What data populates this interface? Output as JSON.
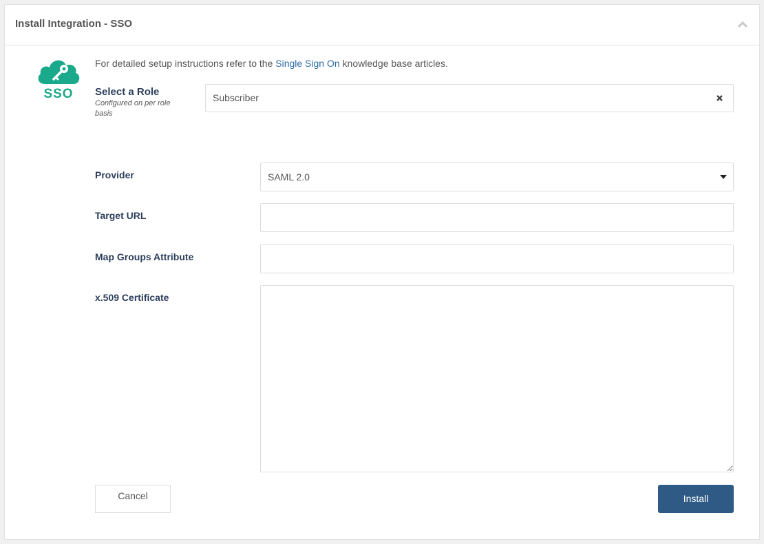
{
  "panel": {
    "title": "Install Integration - SSO"
  },
  "logo": {
    "text": "SSO",
    "icon": "cloud-key-icon",
    "color": "#1aa98a"
  },
  "intro": {
    "prefix": "For detailed setup instructions refer to the ",
    "link": "Single Sign On",
    "suffix": " knowledge base articles."
  },
  "role": {
    "label": "Select a Role",
    "hint": "Configured on per role basis",
    "value": "Subscriber"
  },
  "form": {
    "provider_label": "Provider",
    "provider_value": "SAML 2.0",
    "target_url_label": "Target URL",
    "target_url_value": "",
    "map_groups_label": "Map Groups Attribute",
    "map_groups_value": "",
    "certificate_label": "x.509 Certificate",
    "certificate_value": ""
  },
  "buttons": {
    "cancel": "Cancel",
    "install": "Install"
  },
  "colors": {
    "accent": "#2f5a85",
    "link": "#2e6da4",
    "brand": "#1aa98a"
  }
}
